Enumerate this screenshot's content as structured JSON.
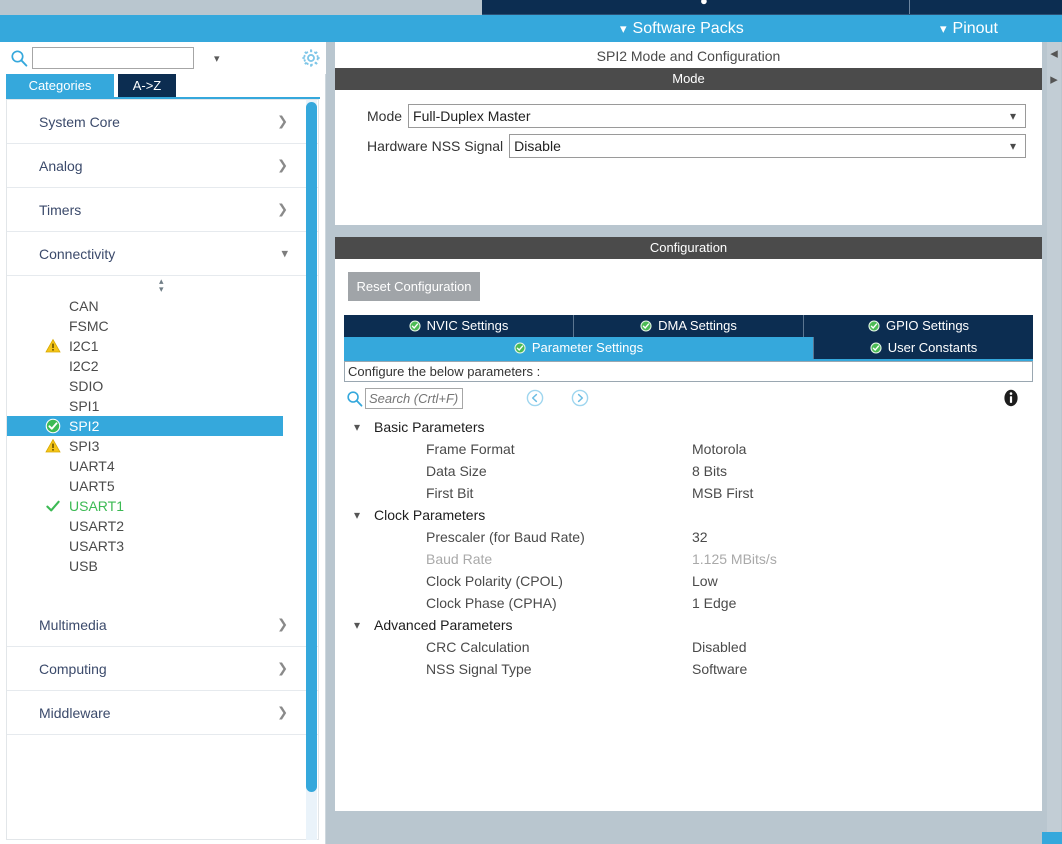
{
  "colors": {
    "brand_blue": "#35a8dc",
    "navy": "#0c2d51",
    "section_grey": "#4b4b4b",
    "panel_bg": "#b9c6cf",
    "ok_green": "#3cba54",
    "warn_yellow": "#f5c518",
    "disabled_grey": "#a9a9a9"
  },
  "topbar": {
    "menu_items": [
      {
        "label": "Software Packs",
        "chevron": "chevron-down-icon"
      },
      {
        "label": "Pinout",
        "chevron": "chevron-down-icon"
      }
    ]
  },
  "sidebar": {
    "search": {
      "value": "",
      "placeholder": ""
    },
    "gear_icon": "gear-icon",
    "search_icon": "search-icon",
    "tabs": [
      {
        "label": "Categories",
        "active": true
      },
      {
        "label": "A->Z",
        "active": false
      }
    ],
    "categories": [
      {
        "label": "System Core",
        "expanded": false,
        "chevron": "chevron-right-icon"
      },
      {
        "label": "Analog",
        "expanded": false,
        "chevron": "chevron-right-icon"
      },
      {
        "label": "Timers",
        "expanded": false,
        "chevron": "chevron-right-icon"
      },
      {
        "label": "Connectivity",
        "expanded": true,
        "chevron": "chevron-down-icon"
      }
    ],
    "peripherals": [
      {
        "label": "CAN",
        "status": "none",
        "selected": false
      },
      {
        "label": "FSMC",
        "status": "none",
        "selected": false
      },
      {
        "label": "I2C1",
        "status": "warning",
        "selected": false
      },
      {
        "label": "I2C2",
        "status": "none",
        "selected": false
      },
      {
        "label": "SDIO",
        "status": "none",
        "selected": false
      },
      {
        "label": "SPI1",
        "status": "none",
        "selected": false
      },
      {
        "label": "SPI2",
        "status": "ok-circle",
        "selected": true
      },
      {
        "label": "SPI3",
        "status": "warning",
        "selected": false
      },
      {
        "label": "UART4",
        "status": "none",
        "selected": false
      },
      {
        "label": "UART5",
        "status": "none",
        "selected": false
      },
      {
        "label": "USART1",
        "status": "ok-check",
        "selected": false
      },
      {
        "label": "USART2",
        "status": "none",
        "selected": false
      },
      {
        "label": "USART3",
        "status": "none",
        "selected": false
      },
      {
        "label": "USB",
        "status": "none",
        "selected": false
      }
    ],
    "categories_bottom": [
      {
        "label": "Multimedia",
        "expanded": false,
        "chevron": "chevron-right-icon"
      },
      {
        "label": "Computing",
        "expanded": false,
        "chevron": "chevron-right-icon"
      },
      {
        "label": "Middleware",
        "expanded": false,
        "chevron": "chevron-right-icon"
      }
    ]
  },
  "main": {
    "pane_title": "SPI2 Mode and Configuration",
    "mode_section": {
      "header": "Mode",
      "fields": [
        {
          "label": "Mode",
          "value": "Full-Duplex Master"
        },
        {
          "label": "Hardware NSS Signal",
          "value": "Disable"
        }
      ]
    },
    "configuration_section": {
      "header": "Configuration",
      "reset_button": "Reset Configuration",
      "tabs_row1": [
        {
          "label": "NVIC Settings",
          "active": false,
          "icon": "check-circle-icon"
        },
        {
          "label": "DMA Settings",
          "active": false,
          "icon": "check-circle-icon"
        },
        {
          "label": "GPIO Settings",
          "active": false,
          "icon": "check-circle-icon"
        }
      ],
      "tabs_row2": [
        {
          "label": "Parameter Settings",
          "active": true,
          "icon": "check-circle-icon"
        },
        {
          "label": "User Constants",
          "active": false,
          "icon": "check-circle-icon"
        }
      ],
      "configure_hint": "Configure the below parameters :",
      "param_search": {
        "value": "",
        "placeholder": "Search (Crtl+F)"
      },
      "nav_prev_icon": "circle-left-arrow-icon",
      "nav_next_icon": "circle-right-arrow-icon",
      "info_icon": "info-icon",
      "param_groups": [
        {
          "label": "Basic Parameters",
          "expanded": true,
          "params": [
            {
              "name": "Frame Format",
              "value": "Motorola",
              "disabled": false
            },
            {
              "name": "Data Size",
              "value": "8 Bits",
              "disabled": false
            },
            {
              "name": "First Bit",
              "value": "MSB First",
              "disabled": false
            }
          ]
        },
        {
          "label": "Clock Parameters",
          "expanded": true,
          "params": [
            {
              "name": "Prescaler (for Baud Rate)",
              "value": "32",
              "disabled": false
            },
            {
              "name": "Baud Rate",
              "value": "1.125 MBits/s",
              "disabled": true
            },
            {
              "name": "Clock Polarity (CPOL)",
              "value": "Low",
              "disabled": false
            },
            {
              "name": "Clock Phase (CPHA)",
              "value": "1 Edge",
              "disabled": false
            }
          ]
        },
        {
          "label": "Advanced Parameters",
          "expanded": true,
          "params": [
            {
              "name": "CRC Calculation",
              "value": "Disabled",
              "disabled": false
            },
            {
              "name": "NSS Signal Type",
              "value": "Software",
              "disabled": false
            }
          ]
        }
      ]
    }
  },
  "scrollbars": {
    "right_up_arrow": "triangle-left-icon",
    "right_down_arrow": "triangle-right-icon"
  }
}
